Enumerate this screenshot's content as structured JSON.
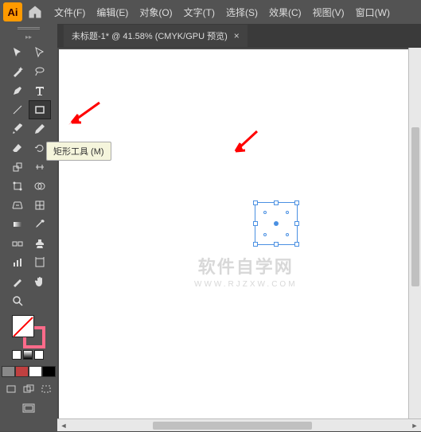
{
  "app": {
    "logo_text": "Ai"
  },
  "menu": {
    "items": [
      "文件(F)",
      "编辑(E)",
      "对象(O)",
      "文字(T)",
      "选择(S)",
      "效果(C)",
      "视图(V)",
      "窗口(W)"
    ]
  },
  "tab": {
    "title": "未标题-1* @ 41.58% (CMYK/GPU 预览)",
    "close": "×"
  },
  "tooltip": {
    "text": "矩形工具 (M)"
  },
  "watermark": {
    "main": "软件自学网",
    "sub": "WWW.RJZXW.COM"
  },
  "colors": {
    "accent": "#ff9a00",
    "selection": "#4a90e2",
    "stroke_swatch": "#ff6b8a",
    "arrow": "#ff0000"
  },
  "swatches": [
    "#888888",
    "#c04040",
    "#ffffff",
    "#000000"
  ]
}
